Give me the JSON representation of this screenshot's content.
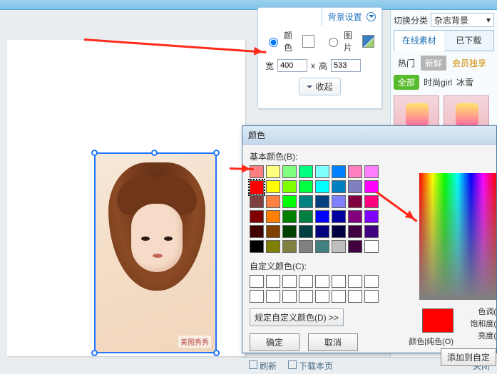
{
  "bg_panel": {
    "title": "背景设置",
    "opt_color": "颜色",
    "opt_image": "图片",
    "w_label": "宽",
    "w_value": "400",
    "x_label": "x",
    "h_label": "高",
    "h_value": "533",
    "collapse": "收起"
  },
  "right": {
    "switch_label": "切换分类",
    "category_value": "杂志背景",
    "tab_online": "在线素材",
    "tab_downloaded": "已下载",
    "filter_hot": "热门",
    "filter_new": "新鲜",
    "filter_vip": "会员独享",
    "cat_all": "全部",
    "cat1": "时尚girl",
    "cat2": "冰雪"
  },
  "color_dlg": {
    "title": "颜色",
    "basic_label": "基本颜色(B):",
    "basic_colors": [
      "#ff8080",
      "#ffff80",
      "#80ff80",
      "#00ff80",
      "#80ffff",
      "#0080ff",
      "#ff80c0",
      "#ff80ff",
      "#ff0000",
      "#ffff00",
      "#80ff00",
      "#00ff40",
      "#00ffff",
      "#0080c0",
      "#8080c0",
      "#ff00ff",
      "#804040",
      "#ff8040",
      "#00ff00",
      "#008080",
      "#004080",
      "#8080ff",
      "#800040",
      "#ff0080",
      "#800000",
      "#ff8000",
      "#008000",
      "#008040",
      "#0000ff",
      "#0000a0",
      "#800080",
      "#8000ff",
      "#400000",
      "#804000",
      "#004000",
      "#004040",
      "#000080",
      "#000040",
      "#400040",
      "#400080",
      "#000000",
      "#808000",
      "#808040",
      "#808080",
      "#408080",
      "#c0c0c0",
      "#400040",
      "#ffffff"
    ],
    "custom_label": "自定义颜色(C):",
    "define_btn": "规定自定义颜色(D) >>",
    "ok": "确定",
    "cancel": "取消",
    "hue_label": "色调(",
    "sat_label": "饱和度(",
    "lum_label": "亮度(",
    "solid_label": "颜色|纯色(O)",
    "add_custom": "添加到自定"
  },
  "footer": {
    "refresh": "刷新",
    "dl_page": "下载本页",
    "close": "关闭"
  },
  "tag": "美图秀秀"
}
